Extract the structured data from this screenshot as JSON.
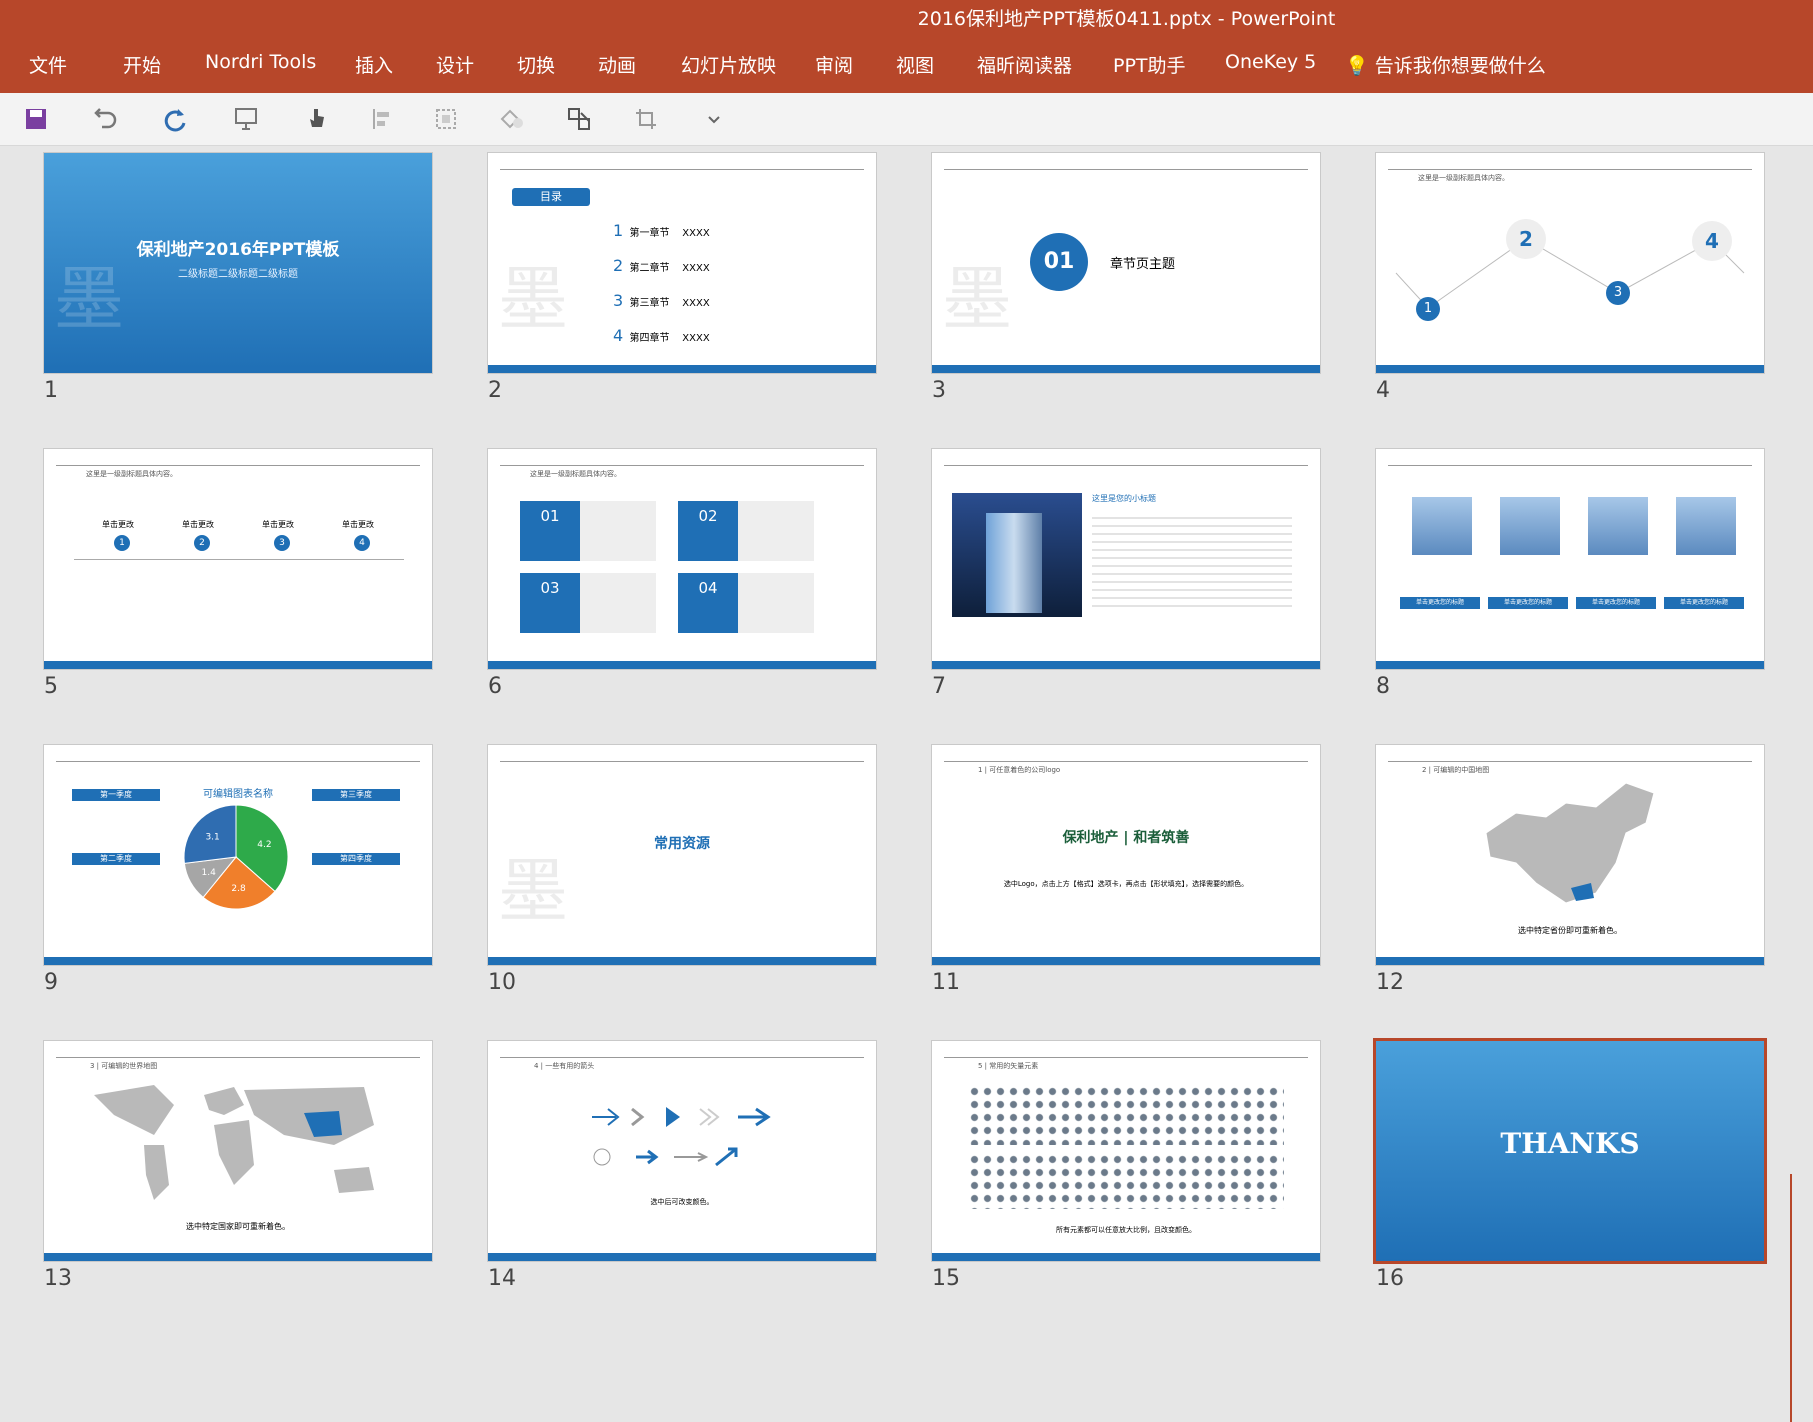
{
  "window": {
    "title": "2016保利地产PPT模板0411.pptx - PowerPoint"
  },
  "ribbon": {
    "tabs": [
      "文件",
      "开始",
      "Nordri Tools",
      "插入",
      "设计",
      "切换",
      "动画",
      "幻灯片放映",
      "审阅",
      "视图",
      "福昕阅读器",
      "PPT助手",
      "OneKey 5"
    ],
    "tell_me": "告诉我你想要做什么"
  },
  "slides": [
    {
      "num": "1",
      "title": "保利地产2016年PPT模板",
      "subtitle": "二级标题二级标题二级标题"
    },
    {
      "num": "2",
      "heading": "目录",
      "items": [
        [
          "1",
          "第一章节",
          "XXXX"
        ],
        [
          "2",
          "第二章节",
          "XXXX"
        ],
        [
          "3",
          "第三章节",
          "XXXX"
        ],
        [
          "4",
          "第四章节",
          "XXXX"
        ]
      ]
    },
    {
      "num": "3",
      "badge": "01",
      "text": "章节页主题"
    },
    {
      "num": "4",
      "caption": "这里是一级副标题具体内容。",
      "steps": [
        "2",
        "4",
        "1",
        "3"
      ]
    },
    {
      "num": "5",
      "caption": "这里是一级副标题具体内容。",
      "labels": [
        "单击更改",
        "单击更改",
        "单击更改",
        "单击更改"
      ],
      "pins": [
        "1",
        "2",
        "3",
        "4"
      ]
    },
    {
      "num": "6",
      "caption": "这里是一级副标题具体内容。",
      "boxes": [
        "01",
        "02",
        "03",
        "04"
      ]
    },
    {
      "num": "7",
      "heading": "这里是您的小标题"
    },
    {
      "num": "8",
      "buttons": [
        "单击更改您的标题",
        "单击更改您的标题",
        "单击更改您的标题",
        "单击更改您的标题"
      ]
    },
    {
      "num": "9",
      "chart_title": "可编辑图表名称",
      "quarters": [
        "第一季度",
        "第二季度",
        "第三季度",
        "第四季度"
      ],
      "chart_data": {
        "type": "pie",
        "categories": [
          "第一季度",
          "第二季度",
          "第三季度",
          "第四季度"
        ],
        "values": [
          4.2,
          2.8,
          1.4,
          3.1
        ],
        "colors": [
          "#2eaa4a",
          "#f07f2b",
          "#a6a6a6",
          "#2f6db1"
        ]
      }
    },
    {
      "num": "10",
      "text": "常用资源"
    },
    {
      "num": "11",
      "caption": "1 | 可任意着色的公司logo",
      "logo": "保利地产 | 和者筑善",
      "note": "选中Logo，点击上方【格式】选项卡，再点击【形状填充】，选择需要的颜色。"
    },
    {
      "num": "12",
      "caption": "2 | 可编辑的中国地图",
      "note": "选中特定省份即可重新着色。"
    },
    {
      "num": "13",
      "caption": "3 | 可编辑的世界地图",
      "note": "选中特定国家即可重新着色。"
    },
    {
      "num": "14",
      "caption": "4 | 一些有用的箭头",
      "note": "选中后可改变颜色。"
    },
    {
      "num": "15",
      "caption": "5 | 常用的矢量元素",
      "note": "所有元素都可以任意放大比例，且改变颜色。"
    },
    {
      "num": "16",
      "text": "THANKS"
    }
  ],
  "colors": {
    "brand": "#b7472a",
    "slide_blue": "#1f6fb5"
  }
}
